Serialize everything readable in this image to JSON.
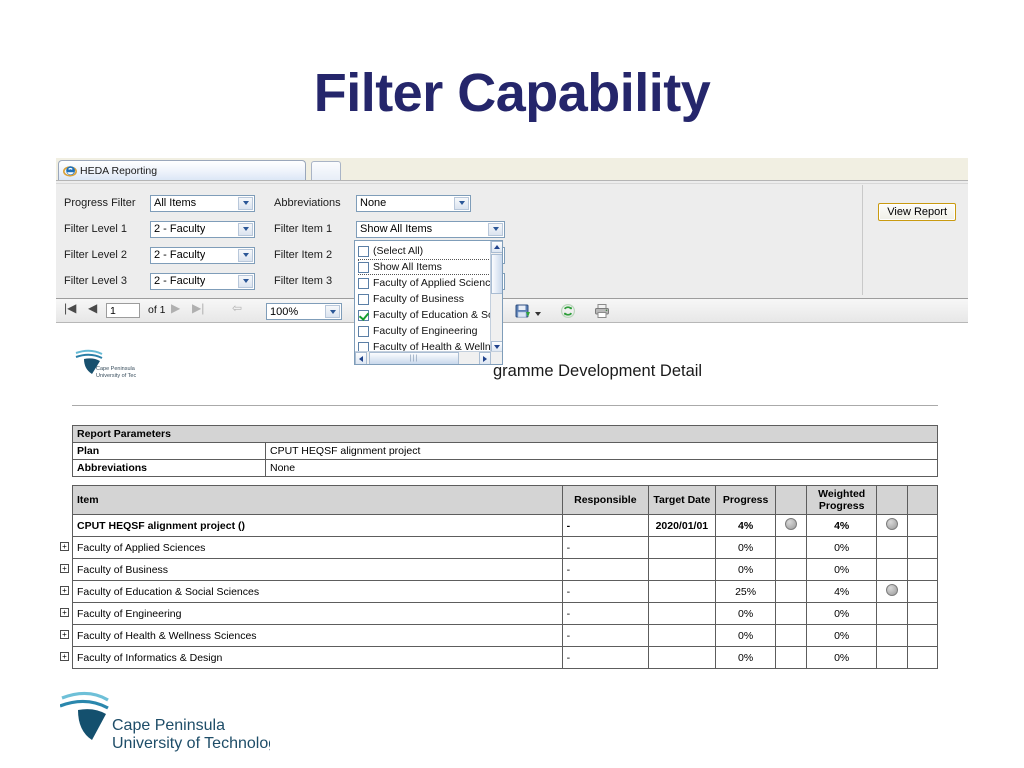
{
  "slide": {
    "title": "Filter Capability",
    "title_color": "#25266b"
  },
  "browser": {
    "tab_label": "HEDA Reporting",
    "new_tab_label": ""
  },
  "filter_panel": {
    "rows": [
      {
        "label": "Progress Filter",
        "value": "All Items"
      },
      {
        "label": "Filter Level 1",
        "value": "2 - Faculty"
      },
      {
        "label": "Filter Level 2",
        "value": "2 - Faculty"
      },
      {
        "label": "Filter Level 3",
        "value": "2 - Faculty"
      }
    ],
    "right_rows": [
      {
        "label": "Abbreviations",
        "value": "None"
      },
      {
        "label": "Filter Item 1",
        "value": "Show All Items"
      },
      {
        "label": "Filter Item 2",
        "value": ""
      },
      {
        "label": "Filter Item 3",
        "value": ""
      }
    ],
    "view_report_label": "View Report"
  },
  "dropdown": {
    "selected_text": "Show All Items",
    "items": [
      {
        "label": "(Select All)",
        "checked": false,
        "focused": false
      },
      {
        "label": "Show All Items",
        "checked": false,
        "focused": true
      },
      {
        "label": "Faculty of Applied Science",
        "checked": false,
        "focused": false
      },
      {
        "label": "Faculty of Business",
        "checked": false,
        "focused": false
      },
      {
        "label": "Faculty of Education & So",
        "checked": true,
        "focused": false
      },
      {
        "label": "Faculty of Engineering",
        "checked": false,
        "focused": false
      },
      {
        "label": "Faculty of Health & Wellne",
        "checked": false,
        "focused": false
      }
    ]
  },
  "report_toolbar": {
    "page_value": "1",
    "page_of": "of 1",
    "zoom_value": "100%",
    "first_icon": "first-page-icon",
    "prev_icon": "previous-page-icon",
    "next_icon": "next-page-icon",
    "last_icon": "last-page-icon",
    "back_icon": "back-to-parent-icon",
    "export_icon": "export-save-icon",
    "refresh_icon": "refresh-icon",
    "print_icon": "print-icon"
  },
  "report": {
    "title": "gramme Development Detail",
    "logo_line1": "Cape Peninsula",
    "logo_line2": "University of Technology",
    "parameters": {
      "header": "Report Parameters",
      "rows": [
        {
          "key": "Plan",
          "value": "CPUT HEQSF alignment project"
        },
        {
          "key": "Abbreviations",
          "value": "None"
        }
      ]
    },
    "items_table": {
      "headers": [
        "Item",
        "Responsible",
        "Target Date",
        "Progress",
        "",
        "Weighted Progress",
        "",
        ""
      ],
      "rows": [
        {
          "expandable": false,
          "bold": true,
          "item": "CPUT HEQSF alignment project ()",
          "responsible": "-",
          "target_date": "2020/01/01",
          "progress": "4%",
          "progress_dot": true,
          "weighted": "4%",
          "weighted_dot": true
        },
        {
          "expandable": true,
          "bold": false,
          "item": "Faculty of Applied Sciences",
          "responsible": "-",
          "target_date": "",
          "progress": "0%",
          "progress_dot": false,
          "weighted": "0%",
          "weighted_dot": false
        },
        {
          "expandable": true,
          "bold": false,
          "item": "Faculty of Business",
          "responsible": "-",
          "target_date": "",
          "progress": "0%",
          "progress_dot": false,
          "weighted": "0%",
          "weighted_dot": false
        },
        {
          "expandable": true,
          "bold": false,
          "item": "Faculty of Education & Social Sciences",
          "responsible": "-",
          "target_date": "",
          "progress": "25%",
          "progress_dot": false,
          "weighted": "4%",
          "weighted_dot": true
        },
        {
          "expandable": true,
          "bold": false,
          "item": "Faculty of Engineering",
          "responsible": "-",
          "target_date": "",
          "progress": "0%",
          "progress_dot": false,
          "weighted": "0%",
          "weighted_dot": false
        },
        {
          "expandable": true,
          "bold": false,
          "item": "Faculty of Health & Wellness Sciences",
          "responsible": "-",
          "target_date": "",
          "progress": "0%",
          "progress_dot": false,
          "weighted": "0%",
          "weighted_dot": false
        },
        {
          "expandable": true,
          "bold": false,
          "item": "Faculty of Informatics & Design",
          "responsible": "-",
          "target_date": "",
          "progress": "0%",
          "progress_dot": false,
          "weighted": "0%",
          "weighted_dot": false
        }
      ]
    }
  },
  "footer_logo": {
    "line1": "Cape Peninsula",
    "line2": "University of Technology"
  }
}
